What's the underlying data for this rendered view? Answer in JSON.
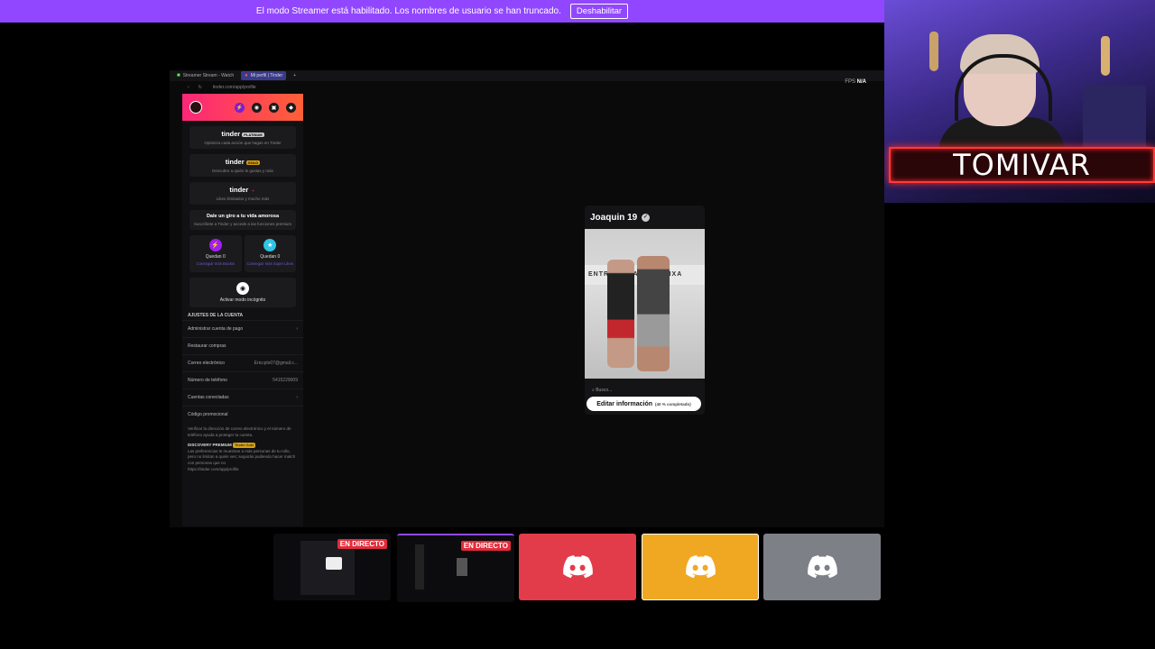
{
  "banner": {
    "message": "El modo Streamer está habilitado. Los nombres de usuario se han truncado.",
    "button_label": "Deshabilitar"
  },
  "webcam": {
    "streamer_name": "TOMIVAR"
  },
  "browser": {
    "tabs": [
      "Streamer Stream - Watch",
      "Mi perfil | Tinder"
    ],
    "url": "tinder.com/app/profile",
    "fps_label": "FPS",
    "fps_value": "N/A"
  },
  "tinder": {
    "plans": [
      {
        "logo": "tinder",
        "badge": "PLATINUM",
        "desc": "Optimiza cada acción que hagas en Tinder"
      },
      {
        "logo": "tinder",
        "badge": "GOLD",
        "desc": "Descubre a quién le gustas y más"
      },
      {
        "logo": "tinder",
        "badge": "+",
        "desc": "Likes ilimitados y mucho más"
      }
    ],
    "promo": {
      "title": "Dale un giro a tu vida amorosa",
      "desc": "Suscríbete a Tinder y accede a las funciones premium"
    },
    "boosts": [
      {
        "label": "Quedan 0",
        "link": "Conseguir más Boosts"
      },
      {
        "label": "Quedan 0",
        "link": "Conseguir más Super Likes"
      }
    ],
    "incognito_label": "Activar modo incógnito",
    "account_section_title": "AJUSTES DE LA CUENTA",
    "settings": [
      {
        "label": "Administrar cuenta de pago",
        "value": ""
      },
      {
        "label": "Restaurar compras",
        "value": ""
      },
      {
        "label": "Correo electrónico",
        "value": "Ericcplo07@gmail.c..."
      },
      {
        "label": "Número de teléfono",
        "value": "5415229009"
      },
      {
        "label": "Cuentas conectadas",
        "value": ""
      },
      {
        "label": "Código promocional",
        "value": ""
      }
    ],
    "footer_text": "Verificar la dirección de correo electrónico y el número de teléfono ayuda a proteger tu cuenta.",
    "discovery_title": "DISCOVERY PREMIUM",
    "discovery_badge": "Tinder Gold",
    "discovery_text": "Las preferencias te muestran a más personas de tu rollo, pero no limitan a quién ves; seguirás pudiendo hacer match con personas que no",
    "footer_url": "https://tinder.com/app/profile"
  },
  "profile_card": {
    "name": "Joaquin",
    "age": "19",
    "photo_wall_text": "ENTRENA BAR LA FAIXA",
    "search_placeholder": "Busco...",
    "edit_button_label": "Editar información",
    "edit_button_progress": "(40 % completado)"
  },
  "stream_tiles": [
    {
      "type": "screen",
      "live_label": "EN DIRECTO"
    },
    {
      "type": "screen",
      "live_label": "EN DIRECTO"
    },
    {
      "type": "discord",
      "color": "#e23c4a"
    },
    {
      "type": "discord",
      "color": "#f0a823",
      "selected": true
    },
    {
      "type": "discord",
      "color": "#7d8087"
    }
  ],
  "colors": {
    "twitch_purple": "#9147ff",
    "tinder_gradient_start": "#fd267a",
    "tinder_gradient_end": "#ff6036",
    "neon_red": "#ff3a3a"
  }
}
